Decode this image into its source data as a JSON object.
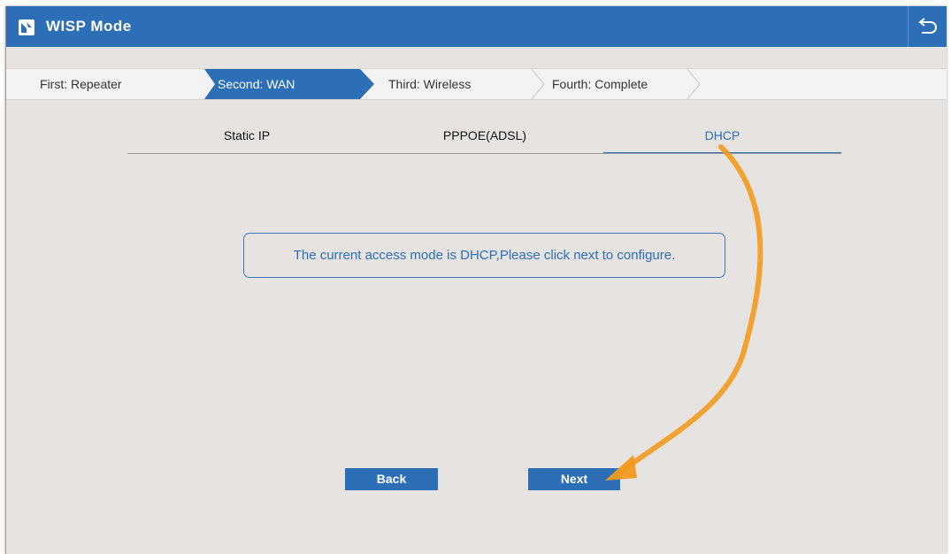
{
  "header": {
    "title": "WISP Mode",
    "logo_icon": "router-logo-icon",
    "back_icon": "return-arrow-icon"
  },
  "steps": [
    {
      "label": "First: Repeater",
      "active": false
    },
    {
      "label": "Second: WAN",
      "active": true
    },
    {
      "label": "Third: Wireless",
      "active": false
    },
    {
      "label": "Fourth: Complete",
      "active": false
    }
  ],
  "mode_tabs": [
    {
      "label": "Static IP",
      "active": false
    },
    {
      "label": "PPPOE(ADSL)",
      "active": false
    },
    {
      "label": "DHCP",
      "active": true
    }
  ],
  "info": {
    "message": "The current access mode is DHCP,Please click next to configure."
  },
  "buttons": {
    "back_label": "Back",
    "next_label": "Next"
  },
  "colors": {
    "accent": "#2d6fb6",
    "background": "#e6e3e1",
    "annotation_arrow": "#f29a1d"
  }
}
